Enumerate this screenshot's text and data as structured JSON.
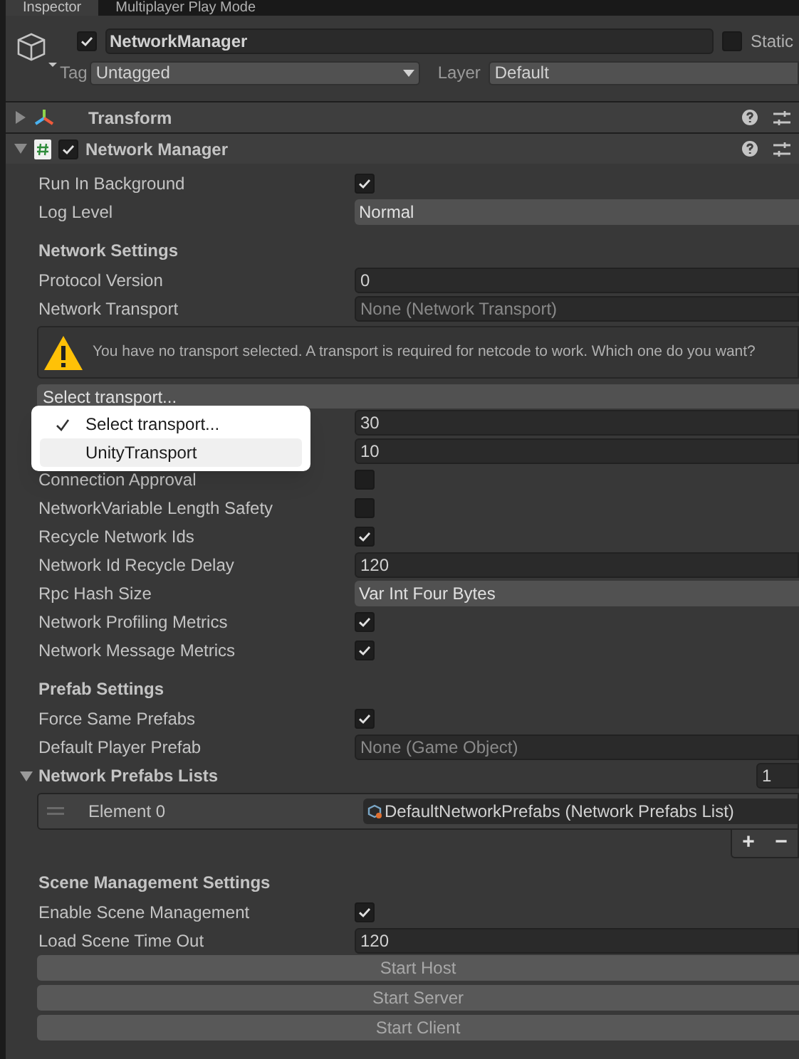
{
  "tabs": [
    {
      "label": "Inspector",
      "selected": true
    },
    {
      "label": "Multiplayer Play Mode",
      "selected": false
    }
  ],
  "object": {
    "active": true,
    "name": "NetworkManager",
    "static": false,
    "static_label": "Static",
    "tag_label": "Tag",
    "tag": "Untagged",
    "layer_label": "Layer",
    "layer": "Default"
  },
  "components": [
    {
      "name": "Transform",
      "expanded": false,
      "kind": "transform"
    },
    {
      "name": "Network Manager",
      "expanded": true,
      "enabled": true,
      "kind": "script"
    }
  ],
  "fields": [
    {
      "kind": "check",
      "label": "Run In Background",
      "checked": true
    },
    {
      "kind": "dropdown",
      "label": "Log Level",
      "value": "Normal"
    },
    {
      "kind": "section",
      "label": "Network Settings"
    },
    {
      "kind": "text",
      "label": "Protocol Version",
      "value": "0"
    },
    {
      "kind": "object",
      "label": "Network Transport",
      "value": "None (Network Transport)"
    },
    {
      "kind": "warning",
      "text": "You have no transport selected. A transport is required for netcode to work. Which one do you want?"
    },
    {
      "kind": "select",
      "value": "Select transport..."
    },
    {
      "kind": "text",
      "value": "30"
    },
    {
      "kind": "text",
      "value": "10"
    },
    {
      "kind": "check",
      "label": "Connection Approval",
      "checked": false
    },
    {
      "kind": "check",
      "label": "NetworkVariable Length Safety",
      "checked": false
    },
    {
      "kind": "check",
      "label": "Recycle Network Ids",
      "checked": true
    },
    {
      "kind": "text",
      "label": "Network Id Recycle Delay",
      "value": "120"
    },
    {
      "kind": "dropdown",
      "label": "Rpc Hash Size",
      "value": "Var Int Four Bytes"
    },
    {
      "kind": "check",
      "label": "Network Profiling Metrics",
      "checked": true
    },
    {
      "kind": "check",
      "label": "Network Message Metrics",
      "checked": true
    },
    {
      "kind": "section",
      "label": "Prefab Settings"
    },
    {
      "kind": "check",
      "label": "Force Same Prefabs",
      "checked": true
    },
    {
      "kind": "object",
      "label": "Default Player Prefab",
      "value": "None (Game Object)"
    },
    {
      "kind": "list",
      "label": "Network Prefabs Lists",
      "expanded": true,
      "count": "1",
      "elements": [
        {
          "label": "Element 0",
          "value": "DefaultNetworkPrefabs (Network Prefabs List)"
        }
      ],
      "add": "+",
      "remove": "−"
    },
    {
      "kind": "section",
      "label": "Scene Management Settings"
    },
    {
      "kind": "check",
      "label": "Enable Scene Management",
      "checked": true
    },
    {
      "kind": "text",
      "label": "Load Scene Time Out",
      "value": "120"
    },
    {
      "kind": "button",
      "label": "Start Host"
    },
    {
      "kind": "button",
      "label": "Start Server"
    },
    {
      "kind": "button",
      "label": "Start Client"
    }
  ],
  "popup": {
    "items": [
      {
        "label": "Select transport...",
        "checked": true,
        "selected": false
      },
      {
        "label": "UnityTransport",
        "checked": false,
        "selected": true
      }
    ]
  }
}
